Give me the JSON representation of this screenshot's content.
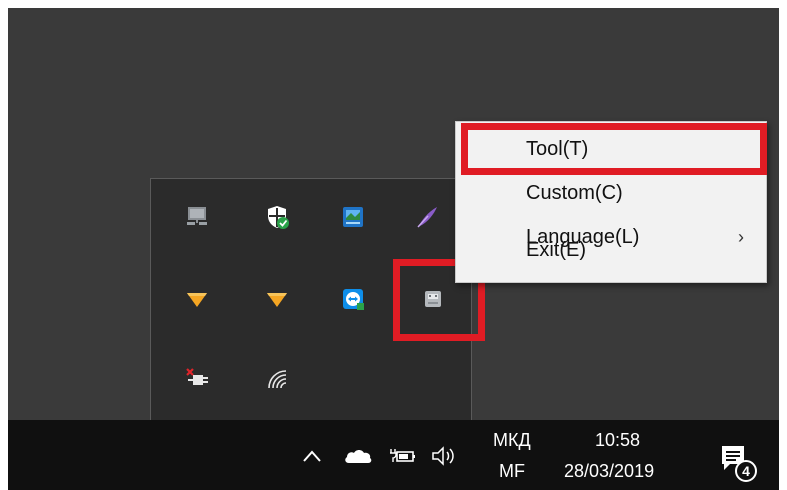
{
  "context_menu": {
    "items": [
      {
        "label": "Tool(T)",
        "has_submenu": false,
        "highlighted": true
      },
      {
        "label": "Custom(C)",
        "has_submenu": false
      },
      {
        "label": "Language(L)",
        "has_submenu": true,
        "submenu_arrow": "›"
      },
      {
        "label": "Exit(E)",
        "has_submenu": false
      }
    ]
  },
  "tray_flyout": {
    "icons": [
      "network-computer-icon",
      "windows-security-icon",
      "blue-app-icon",
      "purple-feather-icon",
      "orange-triangle-icon",
      "orange-triangle-icon",
      "teamviewer-icon",
      "usb-drive-icon",
      "power-plug-unavailable-icon",
      "wifi-signal-icon"
    ]
  },
  "taskbar": {
    "tray_icons": [
      "chevron-up-icon",
      "onedrive-cloud-icon",
      "battery-plug-icon",
      "speaker-volume-icon"
    ],
    "language_line1": "МКД",
    "language_line2": "MF",
    "time": "10:58",
    "date": "28/03/2019",
    "notification_count": "4"
  },
  "colors": {
    "highlight": "#e01c24",
    "desktop": "#3a3a3a",
    "taskbar": "#101010",
    "menu_background": "#f2f2f2"
  }
}
